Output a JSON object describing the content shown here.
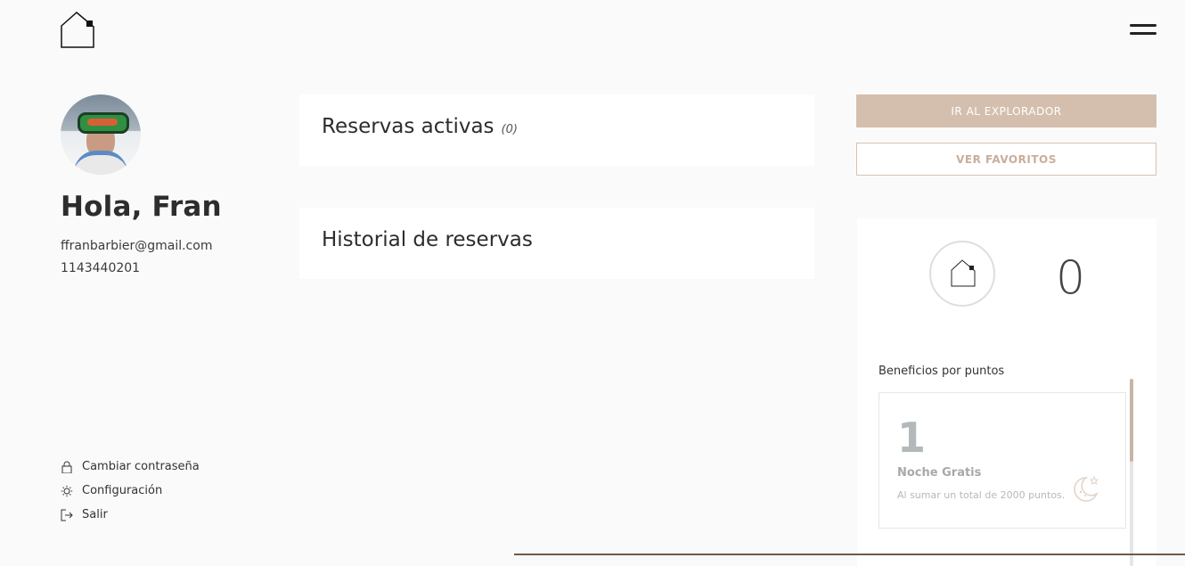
{
  "header": {
    "logo_icon": "house-icon",
    "menu_icon": "hamburger-menu-icon"
  },
  "profile": {
    "greeting": "Hola, Fran",
    "email": "ffranbarbier@gmail.com",
    "phone": "1143440201"
  },
  "sidebar": {
    "items": [
      {
        "label": "Cambiar contraseña",
        "icon": "lock-icon"
      },
      {
        "label": "Configuración",
        "icon": "gear-icon"
      },
      {
        "label": "Salir",
        "icon": "logout-icon"
      }
    ]
  },
  "reservations": {
    "active_title": "Reservas activas",
    "active_count": "(0)",
    "history_title": "Historial de reservas"
  },
  "actions": {
    "explorer_label": "IR AL EXPLORADOR",
    "favorites_label": "VER FAVORITOS"
  },
  "points": {
    "value": "0",
    "benefits_label": "Beneficios por puntos",
    "benefits": [
      {
        "number": "1",
        "name": "Noche Gratis",
        "description": "Al sumar un total de 2000 puntos."
      }
    ]
  },
  "colors": {
    "accent": "#d4bfae",
    "accent_text": "#c9ae9b",
    "background": "#fafafa"
  }
}
